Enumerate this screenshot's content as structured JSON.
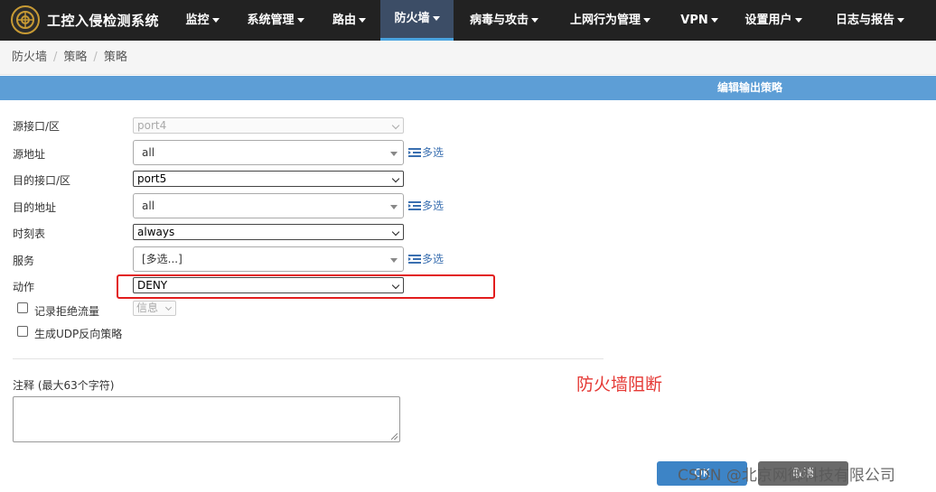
{
  "app": {
    "title": "工控入侵检测系统"
  },
  "nav": {
    "items": [
      {
        "label": "监控"
      },
      {
        "label": "系统管理"
      },
      {
        "label": "路由"
      },
      {
        "label": "防火墙",
        "active": true
      },
      {
        "label": "病毒与攻击"
      },
      {
        "label": "上网行为管理"
      },
      {
        "label": "VPN"
      },
      {
        "label": "设置用户"
      },
      {
        "label": "日志与报告"
      }
    ]
  },
  "breadcrumb": [
    "防火墙",
    "策略",
    "策略"
  ],
  "section": {
    "title": "编辑输出策略"
  },
  "form": {
    "src_iface": {
      "label": "源接口/区",
      "value": "port4"
    },
    "src_addr": {
      "label": "源地址",
      "value": "all",
      "multi_label": "多选"
    },
    "dst_iface": {
      "label": "目的接口/区",
      "value": "port5"
    },
    "dst_addr": {
      "label": "目的地址",
      "value": "all",
      "multi_label": "多选"
    },
    "schedule": {
      "label": "时刻表",
      "value": "always"
    },
    "service": {
      "label": "服务",
      "value": "[多选...]",
      "multi_label": "多选"
    },
    "action": {
      "label": "动作",
      "value": "DENY"
    },
    "log_denied": {
      "label": "记录拒绝流量",
      "level": "信息",
      "checked": false
    },
    "udp_reverse": {
      "label": "生成UDP反向策略",
      "checked": false
    },
    "comment": {
      "label": "注释 (最大63个字符)",
      "value": ""
    }
  },
  "annotation": "防火墙阻断",
  "buttons": {
    "ok": "OK",
    "cancel": "取消"
  },
  "watermark": "CSDN @北京网御科技有限公司",
  "colors": {
    "nav_bg": "#222222",
    "section_bg": "#5d9ed6",
    "highlight": "#e21d1d",
    "annotation": "#e53935"
  }
}
